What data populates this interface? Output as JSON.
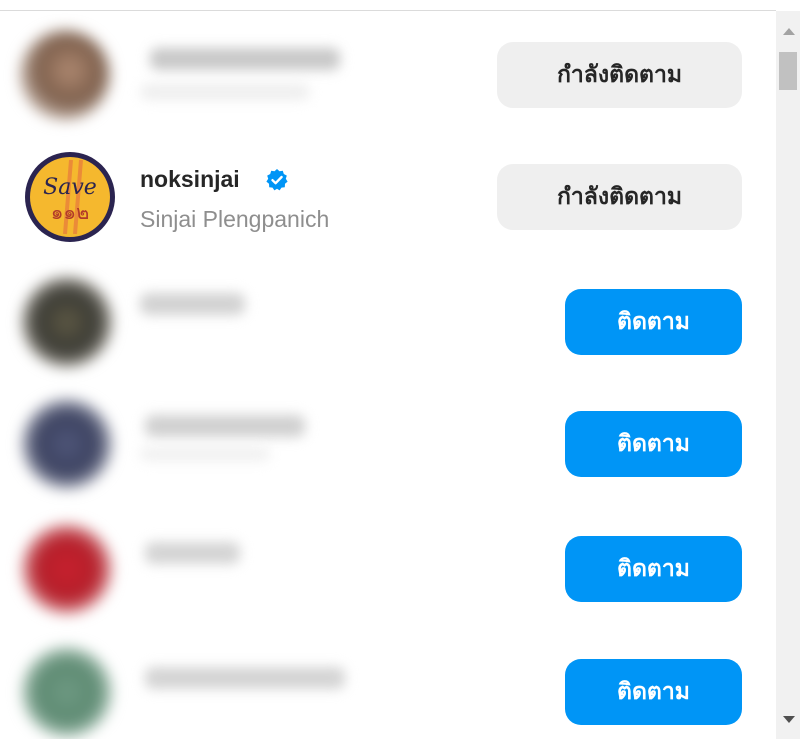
{
  "rows": [
    {
      "username": "",
      "fullname": "",
      "button_label": "กำลังติดตาม",
      "button_state": "following",
      "blurred": true
    },
    {
      "username": "noksinjai",
      "fullname": "Sinjai Plengpanich",
      "verified": true,
      "button_label": "กำลังติดตาม",
      "button_state": "following",
      "blurred": false,
      "avatar_text_top": "Save",
      "avatar_text_bottom": "๑๑๒"
    },
    {
      "username": "",
      "fullname": "",
      "button_label": "ติดตาม",
      "button_state": "follow",
      "blurred": true
    },
    {
      "username": "",
      "fullname": "",
      "button_label": "ติดตาม",
      "button_state": "follow",
      "blurred": true
    },
    {
      "username": "",
      "fullname": "",
      "button_label": "ติดตาม",
      "button_state": "follow",
      "blurred": true
    },
    {
      "username": "",
      "fullname": "",
      "button_label": "ติดตาม",
      "button_state": "follow",
      "blurred": true
    }
  ],
  "colors": {
    "follow_button_bg": "#0095f6",
    "following_button_bg": "#efefef",
    "verified_badge": "#0095f6"
  },
  "icons": {
    "verified": "verified-badge-icon",
    "scroll_up": "scroll-up-arrow-icon",
    "scroll_down": "scroll-down-arrow-icon"
  }
}
